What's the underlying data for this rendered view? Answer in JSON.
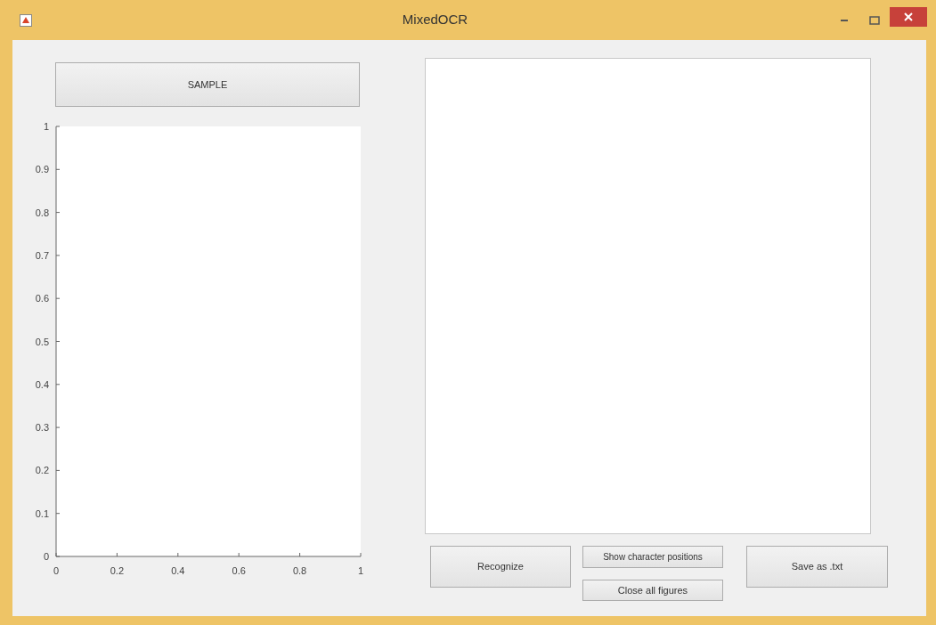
{
  "window": {
    "title": "MixedOCR"
  },
  "sample_button": {
    "label": "SAMPLE"
  },
  "axes": {
    "chart_data": {
      "type": "line",
      "xlim": [
        0,
        1
      ],
      "ylim": [
        0,
        1
      ],
      "xticks": [
        {
          "value": 0,
          "label": "0"
        },
        {
          "value": 0.2,
          "label": "0.2"
        },
        {
          "value": 0.4,
          "label": "0.4"
        },
        {
          "value": 0.6,
          "label": "0.6"
        },
        {
          "value": 0.8,
          "label": "0.8"
        },
        {
          "value": 1,
          "label": "1"
        }
      ],
      "yticks": [
        {
          "value": 0,
          "label": "0"
        },
        {
          "value": 0.1,
          "label": "0.1"
        },
        {
          "value": 0.2,
          "label": "0.2"
        },
        {
          "value": 0.3,
          "label": "0.3"
        },
        {
          "value": 0.4,
          "label": "0.4"
        },
        {
          "value": 0.5,
          "label": "0.5"
        },
        {
          "value": 0.6,
          "label": "0.6"
        },
        {
          "value": 0.7,
          "label": "0.7"
        },
        {
          "value": 0.8,
          "label": "0.8"
        },
        {
          "value": 0.9,
          "label": "0.9"
        },
        {
          "value": 1,
          "label": "1"
        }
      ]
    }
  },
  "buttons": {
    "recognize": "Recognize",
    "show_positions": "Show character positions",
    "close_figures": "Close all figures",
    "save": "Save as .txt"
  }
}
